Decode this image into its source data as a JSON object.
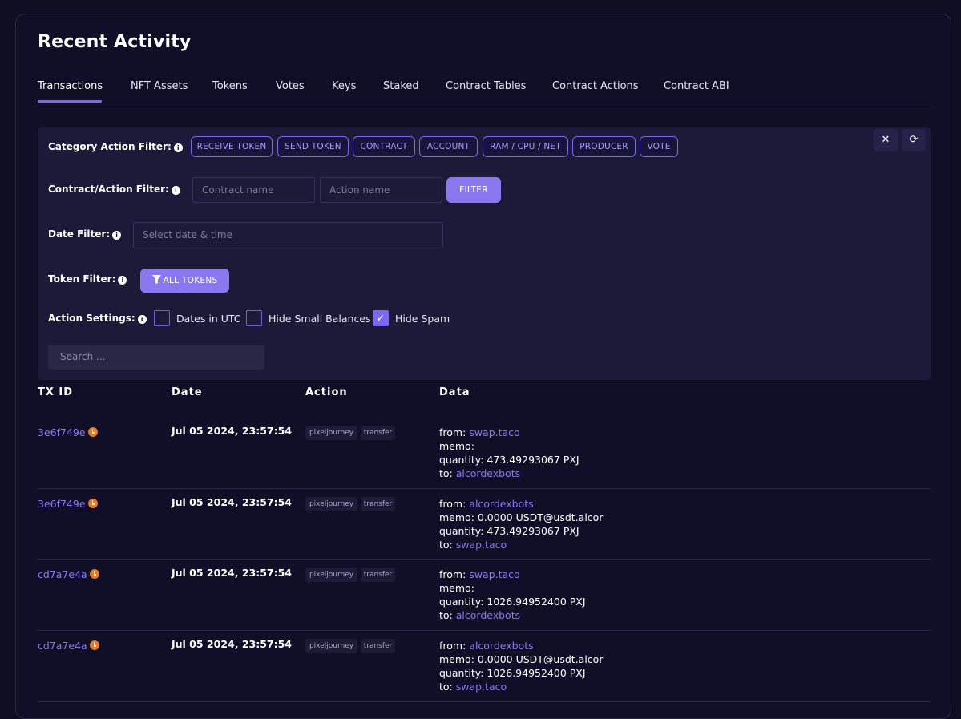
{
  "page": {
    "title": "Recent Activity"
  },
  "tabs": [
    {
      "label": "Transactions",
      "active": true
    },
    {
      "label": "NFT Assets"
    },
    {
      "label": "Tokens"
    },
    {
      "label": "Votes"
    },
    {
      "label": "Keys"
    },
    {
      "label": "Staked"
    },
    {
      "label": "Contract Tables"
    },
    {
      "label": "Contract Actions"
    },
    {
      "label": "Contract ABI"
    }
  ],
  "filters": {
    "category": {
      "label": "Category Action Filter:",
      "chips": [
        "RECEIVE TOKEN",
        "SEND TOKEN",
        "CONTRACT",
        "ACCOUNT",
        "RAM / CPU / NET",
        "PRODUCER",
        "VOTE"
      ]
    },
    "contract_action": {
      "label": "Contract/Action Filter:",
      "contract_placeholder": "Contract name",
      "action_placeholder": "Action name",
      "button": "FILTER"
    },
    "date": {
      "label": "Date Filter:",
      "placeholder": "Select date & time"
    },
    "token": {
      "label": "Token Filter:",
      "button": "ALL TOKENS"
    },
    "settings": {
      "label": "Action Settings:",
      "options": [
        {
          "label": "Dates in UTC",
          "checked": false
        },
        {
          "label": "Hide Small Balances",
          "checked": false
        },
        {
          "label": "Hide Spam",
          "checked": true
        }
      ]
    },
    "search_placeholder": "Search ..."
  },
  "table": {
    "headers": [
      "TX ID",
      "Date",
      "Action",
      "Data"
    ],
    "rows": [
      {
        "txid": "3e6f749e",
        "date": "Jul 05 2024, 23:57:54",
        "contract": "pixeljourney",
        "action": "transfer",
        "from_label": "from:",
        "from": "swap.taco",
        "memo": "memo:",
        "quantity": "quantity: 473.49293067 PXJ",
        "to_label": "to:",
        "to": "alcordexbots"
      },
      {
        "txid": "3e6f749e",
        "date": "Jul 05 2024, 23:57:54",
        "contract": "pixeljourney",
        "action": "transfer",
        "from_label": "from:",
        "from": "alcordexbots",
        "memo": "memo: 0.0000 USDT@usdt.alcor",
        "quantity": "quantity: 473.49293067 PXJ",
        "to_label": "to:",
        "to": "swap.taco"
      },
      {
        "txid": "cd7a7e4a",
        "date": "Jul 05 2024, 23:57:54",
        "contract": "pixeljourney",
        "action": "transfer",
        "from_label": "from:",
        "from": "swap.taco",
        "memo": "memo:",
        "quantity": "quantity: 1026.94952400 PXJ",
        "to_label": "to:",
        "to": "alcordexbots"
      },
      {
        "txid": "cd7a7e4a",
        "date": "Jul 05 2024, 23:57:54",
        "contract": "pixeljourney",
        "action": "transfer",
        "from_label": "from:",
        "from": "alcordexbots",
        "memo": "memo: 0.0000 USDT@usdt.alcor",
        "quantity": "quantity: 1026.94952400 PXJ",
        "to_label": "to:",
        "to": "swap.taco"
      }
    ]
  },
  "colors": {
    "accent": "#7b68ee",
    "link": "#8b77f0",
    "clock": "#e07a2e",
    "background": "#0f0d22",
    "panel": "#1c1a38"
  },
  "icons": {
    "close": "close-icon",
    "refresh": "refresh-icon",
    "filter": "filter-icon",
    "info": "info-icon",
    "clock": "clock-icon",
    "check": "check-icon"
  }
}
